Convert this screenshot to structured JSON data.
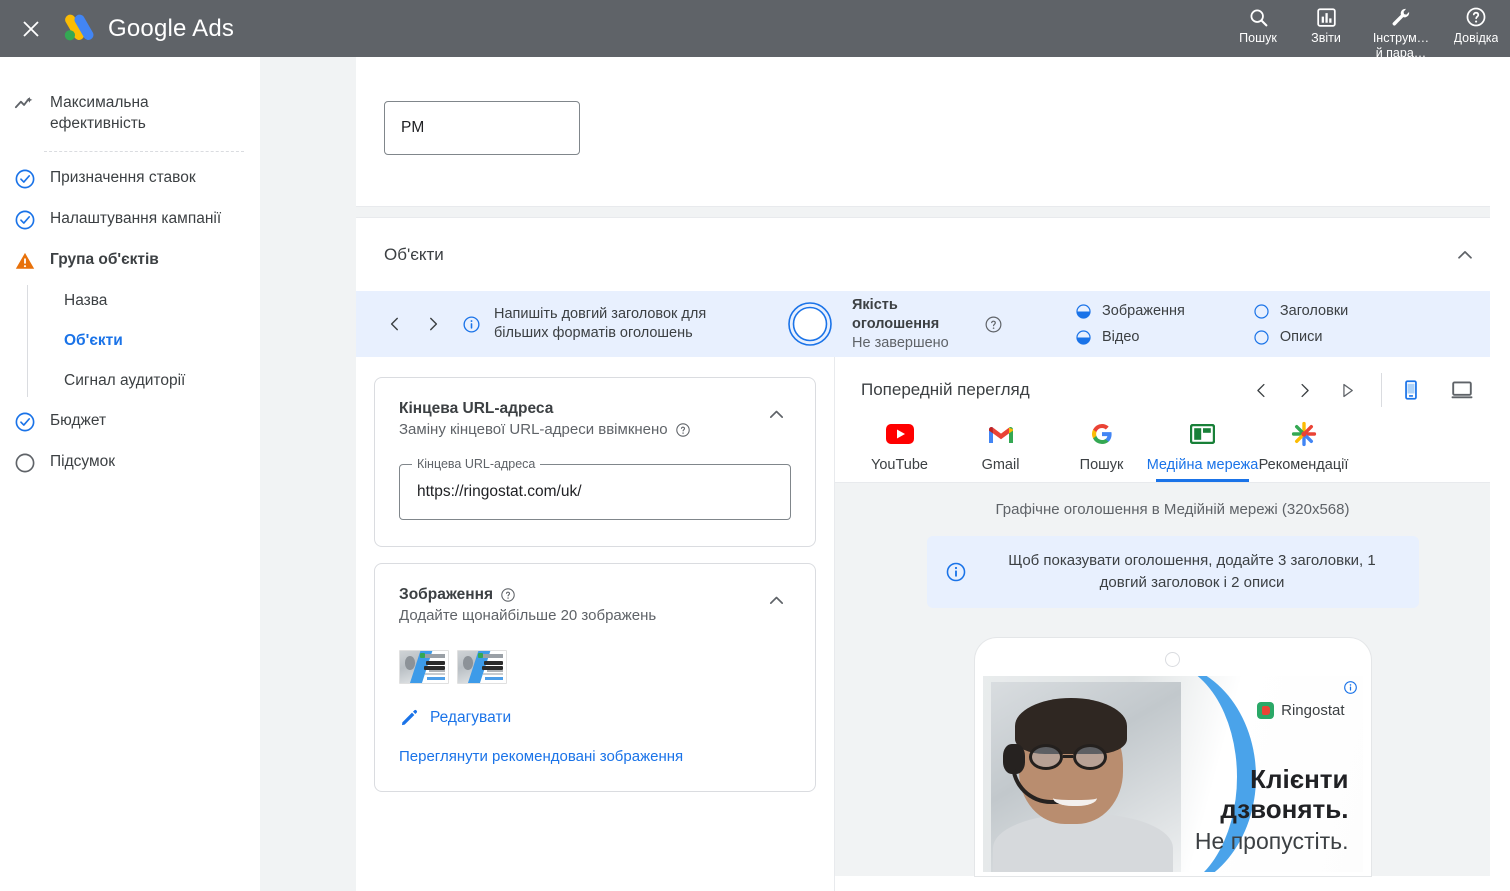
{
  "topbar": {
    "close_icon": "close-icon",
    "brand": "Google Ads",
    "actions": [
      {
        "icon": "search-icon",
        "label": "Пошук"
      },
      {
        "icon": "reports-bar-chart-icon",
        "label": "Звіти"
      },
      {
        "icon": "tools-wrench-icon",
        "label": "Інструм…\nй пара…",
        "line1": "Інструм…",
        "line2": "й пара…"
      },
      {
        "icon": "help-question-icon",
        "label": "Довідка"
      }
    ]
  },
  "sidebar": {
    "items": [
      {
        "icon": "performance-max-icon",
        "label": "Максимальна ефективність",
        "state": "header"
      },
      {
        "icon": "check-circle-icon",
        "label": "Призначення ставок",
        "state": "done"
      },
      {
        "icon": "check-circle-icon",
        "label": "Налаштування кампанії",
        "state": "done"
      },
      {
        "icon": "warning-triangle-icon",
        "label": "Група об'єктів",
        "state": "warning"
      },
      {
        "icon": "check-circle-icon",
        "label": "Бюджет",
        "state": "done"
      },
      {
        "icon": "empty-circle-icon",
        "label": "Підсумок",
        "state": "todo"
      }
    ],
    "subitems": [
      {
        "label": "Назва",
        "active": false
      },
      {
        "label": "Об'єкти",
        "active": true
      },
      {
        "label": "Сигнал аудиторії",
        "active": false
      }
    ]
  },
  "top_card": {
    "input_value": "PM",
    "input_placeholder": ""
  },
  "objects_card": {
    "title": "Об'єкти",
    "collapse_icon": "chevron-up-icon"
  },
  "strength": {
    "prev_icon": "chevron-left-icon",
    "next_icon": "chevron-right-icon",
    "info_icon": "info-circle-icon",
    "tip": "Напишіть довгий заголовок для більших форматів оголошень",
    "ring_icon": "progress-ring-empty",
    "quality_title": "Якість оголошення",
    "quality_status": "Не завершено",
    "help_icon": "help-circle-icon",
    "assets": [
      {
        "label": "Зображення",
        "status": "half"
      },
      {
        "label": "Відео",
        "status": "half"
      },
      {
        "label": "Заголовки",
        "status": "empty"
      },
      {
        "label": "Описи",
        "status": "empty"
      }
    ]
  },
  "url_card": {
    "title": "Кінцева URL-адреса",
    "subtitle": "Заміну кінцевої URL-адреси ввімкнено",
    "help_icon": "help-circle-icon",
    "collapse_icon": "chevron-up-icon",
    "field_label": "Кінцева URL-адреса",
    "field_value": "https://ringostat.com/uk/",
    "field_placeholder": ""
  },
  "images_card": {
    "title": "Зображення",
    "help_icon": "help-circle-icon",
    "subtitle": "Додайте щонайбільше 20 зображень",
    "collapse_icon": "chevron-up-icon",
    "edit_icon": "pencil-icon",
    "edit_label": "Редагувати",
    "recommended_link": "Переглянути рекомендовані зображення",
    "thumbnails": [
      {
        "name": "ringostat-banner-1"
      },
      {
        "name": "ringostat-banner-2"
      }
    ]
  },
  "preview": {
    "title": "Попередній перегляд",
    "prev_icon": "chevron-left-icon",
    "next_icon": "chevron-right-icon",
    "play_icon": "play-triangle-icon",
    "device_mobile_icon": "mobile-device-icon",
    "device_desktop_icon": "desktop-device-icon",
    "active_device": "mobile",
    "channels": [
      {
        "icon": "youtube-icon",
        "label": "YouTube",
        "active": false
      },
      {
        "icon": "gmail-icon",
        "label": "Gmail",
        "active": false
      },
      {
        "icon": "google-g-icon",
        "label": "Пошук",
        "active": false
      },
      {
        "icon": "display-network-icon",
        "label": "Медійна мережа",
        "active": true
      },
      {
        "icon": "discovery-icon",
        "label": "Рекомендації",
        "active": false
      }
    ],
    "caption": "Графічне оголошення в Медійній мережі (320x568)",
    "note_icon": "info-circle-icon",
    "note_text": "Щоб показувати оголошення, додайте 3 заголовки, 1 довгий заголовок і 2 описи",
    "creative": {
      "brand": "Ringostat",
      "headline": "Клієнти дзвонять.",
      "subline": "Не пропустіть.",
      "adinfo_icon": "ad-info-icon"
    }
  }
}
